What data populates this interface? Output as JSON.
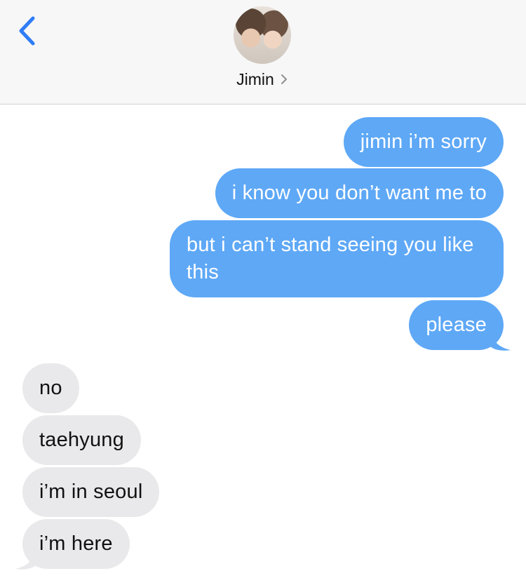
{
  "header": {
    "contact_name": "Jimin",
    "back_icon": "chevron-left-icon",
    "detail_icon": "chevron-right-icon",
    "accent_color": "#2f7cf6"
  },
  "conversation": {
    "sent": [
      "jimin i’m sorry",
      "i know you don’t want me to",
      "but i can’t stand seeing you like this",
      "please"
    ],
    "received": [
      "no",
      "taehyung",
      "i’m in seoul",
      "i’m here"
    ]
  },
  "colors": {
    "sent_bubble": "#5ea8f6",
    "received_bubble": "#e9e9eb",
    "header_bg": "#f7f7f7"
  }
}
